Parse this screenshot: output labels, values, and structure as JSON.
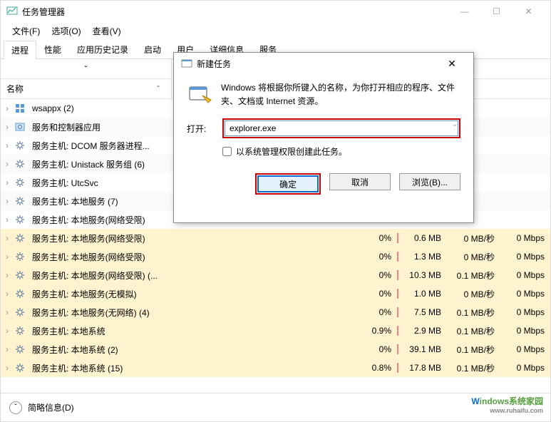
{
  "titlebar": {
    "title": "任务管理器"
  },
  "menu": {
    "file": "文件(F)",
    "options": "选项(O)",
    "view": "查看(V)"
  },
  "tabs": [
    "进程",
    "性能",
    "应用历史记录",
    "启动",
    "用户",
    "详细信息",
    "服务"
  ],
  "colheader": {
    "name": "名称",
    "expand_glyph": "ˇ",
    "chev": "ˇ"
  },
  "rows": [
    {
      "name": "wsappx (2)",
      "icon": "group",
      "cpu": "",
      "mem": "",
      "disk": "",
      "net": ""
    },
    {
      "name": "服务和控制器应用",
      "icon": "service",
      "cpu": "",
      "mem": "",
      "disk": "",
      "net": ""
    },
    {
      "name": "服务主机: DCOM 服务器进程...",
      "icon": "gear",
      "cpu": "",
      "mem": "",
      "disk": "",
      "net": ""
    },
    {
      "name": "服务主机: Unistack 服务组 (6)",
      "icon": "gear",
      "cpu": "",
      "mem": "",
      "disk": "",
      "net": ""
    },
    {
      "name": "服务主机: UtcSvc",
      "icon": "gear",
      "cpu": "",
      "mem": "",
      "disk": "",
      "net": ""
    },
    {
      "name": "服务主机: 本地服务 (7)",
      "icon": "gear",
      "cpu": "",
      "mem": "",
      "disk": "",
      "net": ""
    },
    {
      "name": "服务主机: 本地服务(网络受限)",
      "icon": "gear",
      "cpu": "",
      "mem": "",
      "disk": "",
      "net": ""
    },
    {
      "name": "服务主机: 本地服务(网络受限)",
      "icon": "gear",
      "cpu": "0%",
      "mem": "0.6 MB",
      "disk": "0 MB/秒",
      "net": "0 Mbps"
    },
    {
      "name": "服务主机: 本地服务(网络受限)",
      "icon": "gear",
      "cpu": "0%",
      "mem": "1.3 MB",
      "disk": "0 MB/秒",
      "net": "0 Mbps"
    },
    {
      "name": "服务主机: 本地服务(网络受限) (...",
      "icon": "gear",
      "cpu": "0%",
      "mem": "10.3 MB",
      "disk": "0.1 MB/秒",
      "net": "0 Mbps"
    },
    {
      "name": "服务主机: 本地服务(无模拟)",
      "icon": "gear",
      "cpu": "0%",
      "mem": "1.0 MB",
      "disk": "0 MB/秒",
      "net": "0 Mbps"
    },
    {
      "name": "服务主机: 本地服务(无网络) (4)",
      "icon": "gear",
      "cpu": "0%",
      "mem": "7.5 MB",
      "disk": "0.1 MB/秒",
      "net": "0 Mbps"
    },
    {
      "name": "服务主机: 本地系统",
      "icon": "gear",
      "cpu": "0.9%",
      "mem": "2.9 MB",
      "disk": "0.1 MB/秒",
      "net": "0 Mbps"
    },
    {
      "name": "服务主机: 本地系统 (2)",
      "icon": "gear",
      "cpu": "0%",
      "mem": "39.1 MB",
      "disk": "0.1 MB/秒",
      "net": "0 Mbps"
    },
    {
      "name": "服务主机: 本地系统 (15)",
      "icon": "gear",
      "cpu": "0.8%",
      "mem": "17.8 MB",
      "disk": "0.1 MB/秒",
      "net": "0 Mbps"
    }
  ],
  "footer": {
    "brief": "简略信息(D)"
  },
  "dialog": {
    "title": "新建任务",
    "info": "Windows 将根据你所键入的名称，为你打开相应的程序、文件夹、文档或 Internet 资源。",
    "open_label": "打开:",
    "input_value": "explorer.exe",
    "admin_check": "以系统管理权限创建此任务。",
    "ok": "确定",
    "cancel": "取消",
    "browse": "浏览(B)..."
  },
  "watermark": {
    "w": "W",
    "text": "indows系统家园",
    "sub": "www.ruhaifu.com"
  }
}
